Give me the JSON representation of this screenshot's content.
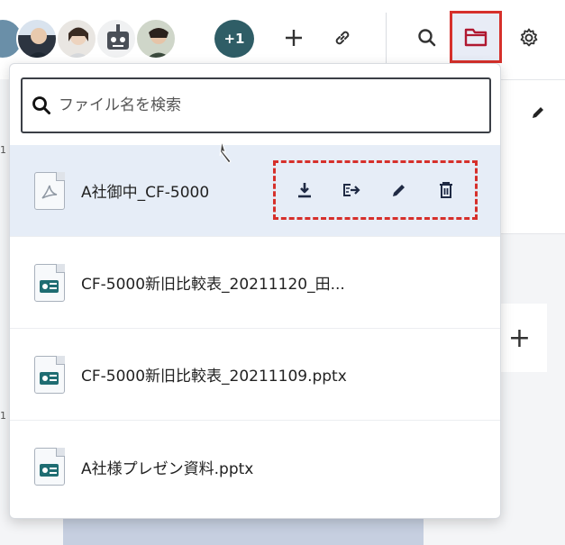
{
  "toolbar": {
    "more_count": "+1",
    "accent_color": "#2f5d66",
    "highlight_color": "#d6302b",
    "icons": [
      "add-icon",
      "link-icon",
      "search-icon",
      "folder-icon",
      "gear-icon"
    ]
  },
  "search": {
    "placeholder": "ファイル名を検索"
  },
  "files": [
    {
      "name": "A社御中_CF-5000",
      "type": "pdf"
    },
    {
      "name": "CF-5000新旧比較表_20211120_田...",
      "type": "pptx"
    },
    {
      "name": "CF-5000新旧比較表_20211109.pptx",
      "type": "pptx"
    },
    {
      "name": "A社様プレゼン資料.pptx",
      "type": "pptx"
    }
  ],
  "file_actions": [
    "download-icon",
    "share-icon",
    "edit-icon",
    "trash-icon"
  ],
  "background": {
    "left_markers": [
      "1",
      "1"
    ]
  }
}
